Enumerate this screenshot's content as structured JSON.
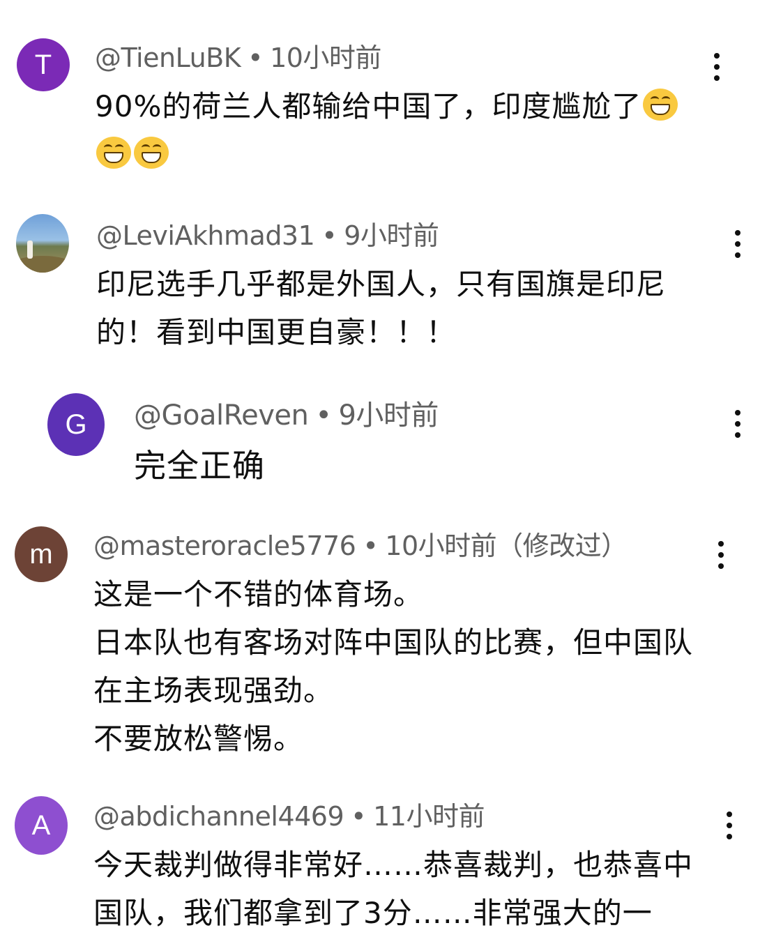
{
  "comments": [
    {
      "avatar": {
        "letter": "T",
        "color": "#7b2ab6"
      },
      "handle": "@TienLuBK",
      "time": "10小时前",
      "lines": [
        "90%的荷兰人都输给中国了，印度尴尬了"
      ],
      "emoji": "grinning-squinting-face",
      "emoji_count": 3
    },
    {
      "avatar": {
        "letter": "",
        "type": "photo"
      },
      "handle": "@LeviAkhmad31",
      "time": "9小时前",
      "lines": [
        "印尼选手几乎都是外国人，只有国旗是印尼",
        "的！看到中国更自豪！！！"
      ]
    },
    {
      "avatar": {
        "letter": "G",
        "color": "#5c31b5"
      },
      "handle": "@GoalReven",
      "time": "9小时前",
      "lines": [
        "完全正确"
      ],
      "reply": true
    },
    {
      "avatar": {
        "letter": "m",
        "color": "#6d4336"
      },
      "handle": "@masteroracle5776",
      "time": "10小时前（修改过）",
      "lines": [
        "这是一个不错的体育场。",
        "日本队也有客场对阵中国队的比赛，但中国队",
        "在主场表现强劲。",
        "不要放松警惕。"
      ]
    },
    {
      "avatar": {
        "letter": "A",
        "color": "#8e4fd0"
      },
      "handle": "@abdichannel4469",
      "time": "11小时前",
      "lines": [
        "今天裁判做得非常好……恭喜裁判，也恭喜中",
        "国队，我们都拿到了3分……非常强大的一"
      ]
    }
  ],
  "separator": "•",
  "icons": {
    "more": "more-vert-icon",
    "emoji": "grinning-squinting-face-icon"
  }
}
